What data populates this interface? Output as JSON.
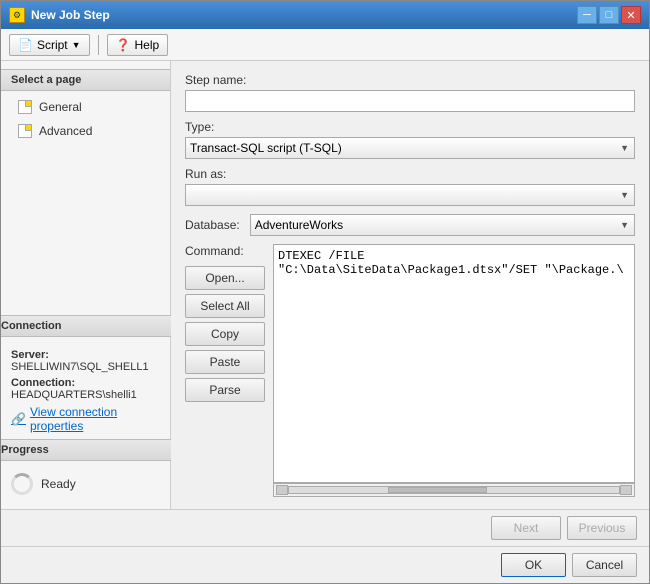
{
  "window": {
    "title": "New Job Step",
    "icon": "⚙"
  },
  "toolbar": {
    "script_label": "Script",
    "help_label": "Help"
  },
  "sidebar": {
    "section_title": "Select a page",
    "items": [
      {
        "label": "General",
        "id": "general"
      },
      {
        "label": "Advanced",
        "id": "advanced"
      }
    ]
  },
  "connection": {
    "section_title": "Connection",
    "server_label": "Server:",
    "server_value": "SHELLIWIN7\\SQL_SHELL1",
    "connection_label": "Connection:",
    "connection_value": "HEADQUARTERS\\shelli1",
    "link_label": "View connection properties"
  },
  "progress": {
    "section_title": "Progress",
    "status": "Ready"
  },
  "form": {
    "step_name_label": "Step name:",
    "step_name_value": "",
    "type_label": "Type:",
    "type_value": "Transact-SQL script (T-SQL)",
    "run_as_label": "Run as:",
    "run_as_value": "",
    "database_label": "Database:",
    "database_value": "AdventureWorks",
    "command_label": "Command:",
    "command_value": "DTEXEC /FILE \"C:\\Data\\SiteData\\Package1.dtsx\"/SET \"\\Package.\\"
  },
  "buttons": {
    "open": "Open...",
    "select_all": "Select All",
    "copy": "Copy",
    "paste": "Paste",
    "parse": "Parse",
    "next": "Next",
    "previous": "Previous",
    "ok": "OK",
    "cancel": "Cancel"
  }
}
